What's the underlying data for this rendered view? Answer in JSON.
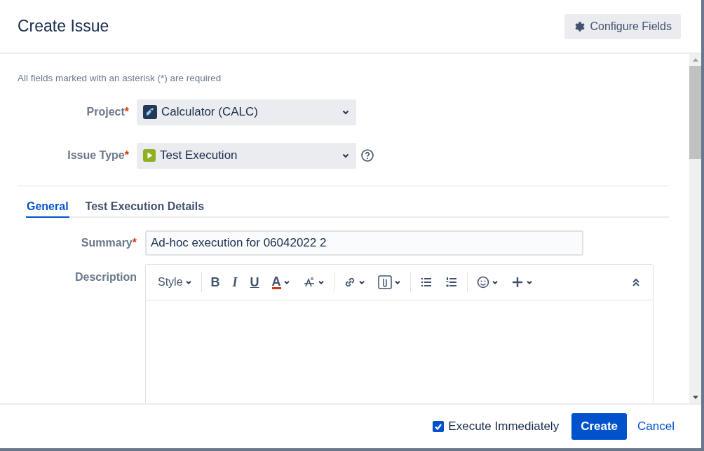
{
  "dialog": {
    "title": "Create Issue",
    "configure_button": "Configure Fields"
  },
  "required_note": "All fields marked with an asterisk (*) are required",
  "asterisk": "*",
  "project": {
    "label": "Project",
    "value": "Calculator (CALC)"
  },
  "issue_type": {
    "label": "Issue Type",
    "value": "Test Execution"
  },
  "tabs": [
    {
      "label": "General",
      "selected": true
    },
    {
      "label": "Test Execution Details",
      "selected": false
    }
  ],
  "summary": {
    "label": "Summary",
    "value": "Ad-hoc execution for 06042022 2"
  },
  "description": {
    "label": "Description"
  },
  "toolbar": [
    {
      "kind": "style",
      "label": "Style"
    },
    {
      "kind": "sep"
    },
    {
      "kind": "char",
      "label": "B"
    },
    {
      "kind": "char",
      "label": "I"
    },
    {
      "kind": "char",
      "label": "U"
    },
    {
      "kind": "color",
      "label": "A"
    },
    {
      "kind": "effects"
    },
    {
      "kind": "sep"
    },
    {
      "kind": "link"
    },
    {
      "kind": "attach"
    },
    {
      "kind": "sep"
    },
    {
      "kind": "bullets"
    },
    {
      "kind": "numbers"
    },
    {
      "kind": "sep"
    },
    {
      "kind": "emoji"
    },
    {
      "kind": "plus"
    },
    {
      "kind": "spacer"
    },
    {
      "kind": "collapse"
    }
  ],
  "footer": {
    "execute_immediately": {
      "label": "Execute Immediately",
      "checked": true
    },
    "create_button": "Create",
    "cancel_link": "Cancel"
  }
}
